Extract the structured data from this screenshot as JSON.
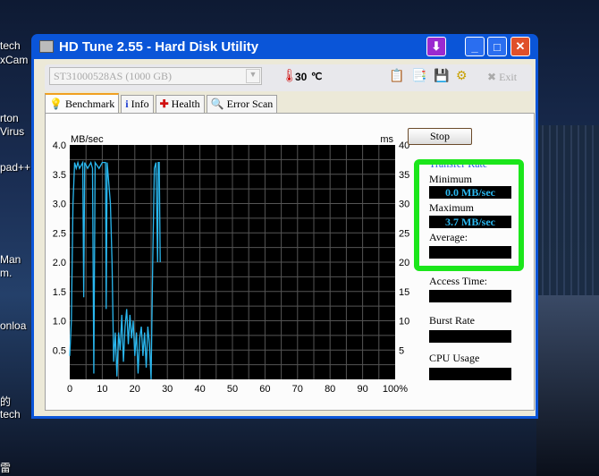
{
  "desktop": {
    "icons": [
      "tech",
      "xCam",
      "rton",
      "Virus",
      "pad++",
      "Man",
      "m.",
      "onloa",
      "的",
      "tech",
      "雷"
    ]
  },
  "window": {
    "title": "HD Tune 2.55 - Hard Disk Utility",
    "minimize": "_",
    "maximize": "□",
    "close": "✕"
  },
  "toolbar": {
    "drive": "ST31000528AS (1000 GB)",
    "temperature": "30",
    "exit": "Exit"
  },
  "tabs": [
    {
      "label": "Benchmark"
    },
    {
      "label": "Info"
    },
    {
      "label": "Health"
    },
    {
      "label": "Error Scan"
    }
  ],
  "side": {
    "stop": "Stop",
    "transfer_rate": "Transfer Rate",
    "minimum_label": "Minimum",
    "minimum": "0.0 MB/sec",
    "maximum_label": "Maximum",
    "maximum": "3.7 MB/sec",
    "average_label": "Average:",
    "access_label": "Access Time:",
    "burst_label": "Burst Rate",
    "cpu_label": "CPU Usage"
  },
  "chart_data": {
    "type": "line",
    "ylabel": "MB/sec",
    "y2label": "ms",
    "ylim": [
      0,
      4.0
    ],
    "y2lim": [
      0,
      40
    ],
    "xlim": [
      0,
      100
    ],
    "yticks": [
      "0.5",
      "1.0",
      "1.5",
      "2.0",
      "2.5",
      "3.0",
      "3.5",
      "4.0"
    ],
    "y2ticks": [
      "5",
      "10",
      "15",
      "20",
      "25",
      "30",
      "35",
      "40"
    ],
    "xticks": [
      "0",
      "10",
      "20",
      "30",
      "40",
      "50",
      "60",
      "70",
      "80",
      "90",
      "100%"
    ],
    "series": [
      {
        "name": "Transfer rate",
        "color": "#2ab8f0",
        "points": [
          [
            0,
            0.4
          ],
          [
            0.5,
            1.0
          ],
          [
            1,
            3.0
          ],
          [
            1.5,
            3.7
          ],
          [
            2,
            3.6
          ],
          [
            2.5,
            3.7
          ],
          [
            3,
            3.6
          ],
          [
            4,
            3.7
          ],
          [
            4.3,
            1.4
          ],
          [
            4.6,
            3.7
          ],
          [
            5.5,
            3.6
          ],
          [
            6.5,
            3.7
          ],
          [
            7,
            3.6
          ],
          [
            7.4,
            0.1
          ],
          [
            7.8,
            3.7
          ],
          [
            9,
            3.6
          ],
          [
            10,
            3.7
          ],
          [
            11,
            3.7
          ],
          [
            11.2,
            1.2
          ],
          [
            11.5,
            3.7
          ],
          [
            12.5,
            3.0
          ],
          [
            13,
            2.0
          ],
          [
            13.5,
            0.3
          ],
          [
            14,
            0.8
          ],
          [
            14.5,
            0.05
          ],
          [
            15,
            0.8
          ],
          [
            15.5,
            0.5
          ],
          [
            16,
            1.1
          ],
          [
            16.5,
            0.3
          ],
          [
            17,
            0.9
          ],
          [
            17.5,
            1.2
          ],
          [
            18,
            0.6
          ],
          [
            18.5,
            1.1
          ],
          [
            19,
            0.7
          ],
          [
            19.5,
            1.0
          ],
          [
            20,
            0.4
          ],
          [
            20.5,
            0.8
          ],
          [
            21,
            0.1
          ],
          [
            21.5,
            0.7
          ],
          [
            22,
            0.9
          ],
          [
            22.5,
            0.4
          ],
          [
            23,
            0.8
          ],
          [
            23.5,
            0.2
          ],
          [
            24,
            0.9
          ],
          [
            24.5,
            0.6
          ],
          [
            25,
            0.0
          ],
          [
            25.5,
            2.0
          ],
          [
            26,
            3.6
          ],
          [
            26.5,
            3.7
          ],
          [
            27,
            2.0
          ],
          [
            27.2,
            3.7
          ],
          [
            27.5,
            3.7
          ],
          [
            27.8,
            2.0
          ]
        ]
      }
    ]
  }
}
